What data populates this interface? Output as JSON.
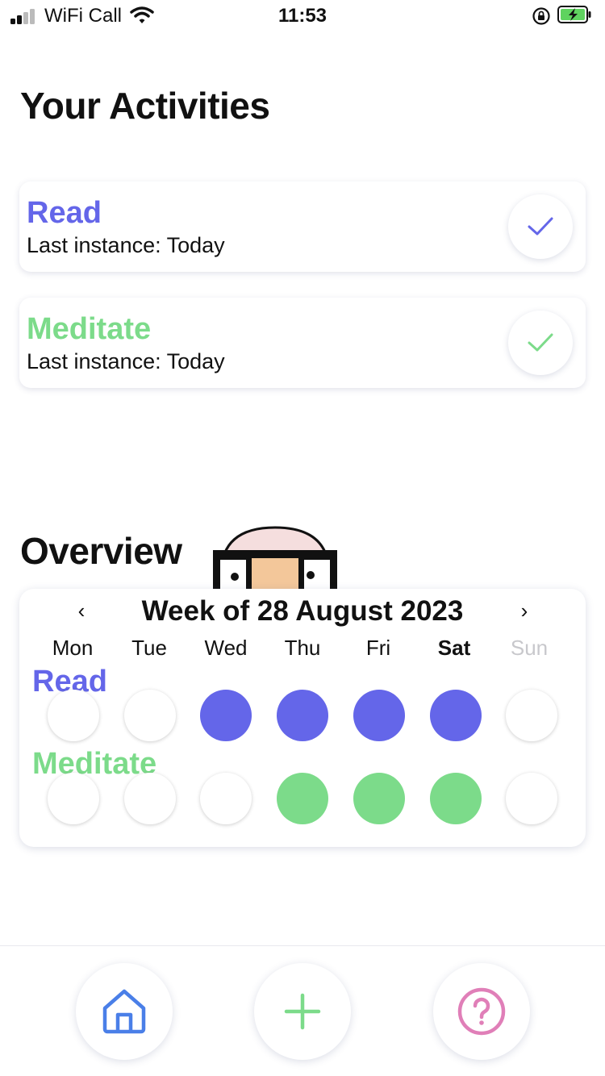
{
  "status": {
    "carrier": "WiFi Call",
    "time": "11:53"
  },
  "header": {
    "title": "Your Activities"
  },
  "activities": [
    {
      "name": "Read",
      "subtitle": "Last instance: Today",
      "color": "#6466e9"
    },
    {
      "name": "Meditate",
      "subtitle": "Last instance: Today",
      "color": "#7cdb8a"
    }
  ],
  "overview": {
    "title": "Overview",
    "week_label": "Week of 28 August 2023",
    "prev_label": "‹",
    "next_label": "›",
    "days": [
      "Mon",
      "Tue",
      "Wed",
      "Thu",
      "Fri",
      "Sat",
      "Sun"
    ],
    "current_day": "Sat",
    "rows": [
      {
        "name": "Read",
        "color": "#6466e9",
        "done": [
          false,
          false,
          true,
          true,
          true,
          true,
          false
        ]
      },
      {
        "name": "Meditate",
        "color": "#7cdb8a",
        "done": [
          false,
          false,
          false,
          true,
          true,
          true,
          false
        ]
      }
    ]
  },
  "tabbar": {
    "items": [
      {
        "name": "home",
        "icon": "home-icon",
        "color": "#4a7fe8"
      },
      {
        "name": "add",
        "icon": "plus-icon",
        "color": "#7cdb8a"
      },
      {
        "name": "help",
        "icon": "question-icon",
        "color": "#e07fb8"
      }
    ]
  }
}
